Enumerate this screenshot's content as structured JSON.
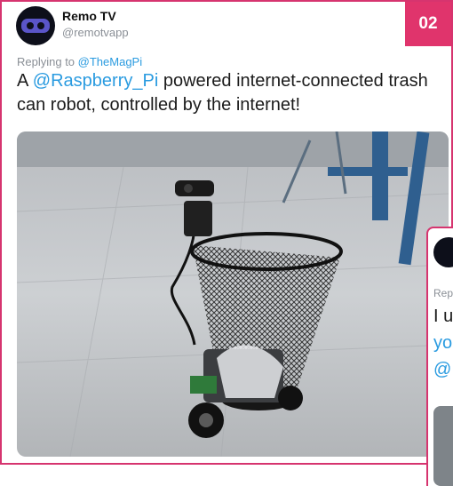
{
  "badge": "02",
  "tweet": {
    "display_name": "Remo TV",
    "handle": "@remotvapp",
    "replying_to_prefix": "Replying to",
    "replying_to_user": "@TheMagPi",
    "text_before": "A ",
    "text_mention": "@Raspberry_Pi",
    "text_after": " powered internet-connected trash can robot, controlled by the internet!"
  },
  "second_tweet_partial": {
    "reply_fragment": "Repl",
    "line1": "I u",
    "line2": "yo",
    "line3": "@"
  },
  "colors": {
    "accent": "#e0346c",
    "link": "#2a9be0"
  },
  "icons": [
    "remo-logo-icon"
  ]
}
